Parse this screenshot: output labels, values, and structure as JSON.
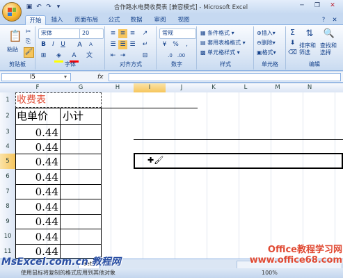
{
  "window": {
    "title": "合作路水电费收费表 [兼容模式] - Microsoft Excel"
  },
  "tabs": [
    "开始",
    "插入",
    "页面布局",
    "公式",
    "数据",
    "审阅",
    "视图"
  ],
  "ribbon": {
    "clipboard": {
      "paste": "粘贴",
      "label": "剪贴板"
    },
    "font": {
      "name": "宋体",
      "size": "20",
      "label": "字体",
      "bold": "B",
      "italic": "I",
      "underline": "U",
      "grow": "A",
      "shrink": "A",
      "color_letter": "A"
    },
    "alignment": {
      "label": "对齐方式"
    },
    "number": {
      "format": "常规",
      "percent": "%",
      "comma": ",",
      "label": "数字"
    },
    "styles": {
      "conditional": "条件格式",
      "table": "套用表格格式",
      "cell": "单元格样式",
      "label": "样式"
    },
    "cells": {
      "insert": "插入",
      "delete": "删除",
      "format": "格式",
      "label": "单元格"
    },
    "editing": {
      "sum": "Σ",
      "sort": "排序和",
      "sort2": "筛选",
      "find": "查找和",
      "find2": "选择",
      "label": "编辑"
    }
  },
  "formula_bar": {
    "name_box": "I5",
    "fx": "fx"
  },
  "columns": [
    "F",
    "G",
    "H",
    "I",
    "J",
    "K",
    "L",
    "M",
    "N"
  ],
  "rows": [
    "1",
    "2",
    "3",
    "4",
    "5",
    "6",
    "7",
    "8",
    "9",
    "10",
    "11",
    "12"
  ],
  "cells": {
    "F1": "收费表",
    "F2": "电单价",
    "G2": "小计",
    "values": [
      "0.44",
      "0.44",
      "0.44",
      "0.44",
      "0.44",
      "0.44",
      "0.44",
      "0.44",
      "0.44",
      "0.44"
    ]
  },
  "sheet_tab": "eet3",
  "status_text": "使用鼠标将复制的格式应用到其他对象",
  "zoom": "100%",
  "watermarks": {
    "left": "MsExcel.com.cn 教程网",
    "right": "Office教程学习网 www.office68.com"
  },
  "colors": {
    "accent": "#15428b",
    "title_red": "#e04a33",
    "selection": "#f6c55c"
  }
}
